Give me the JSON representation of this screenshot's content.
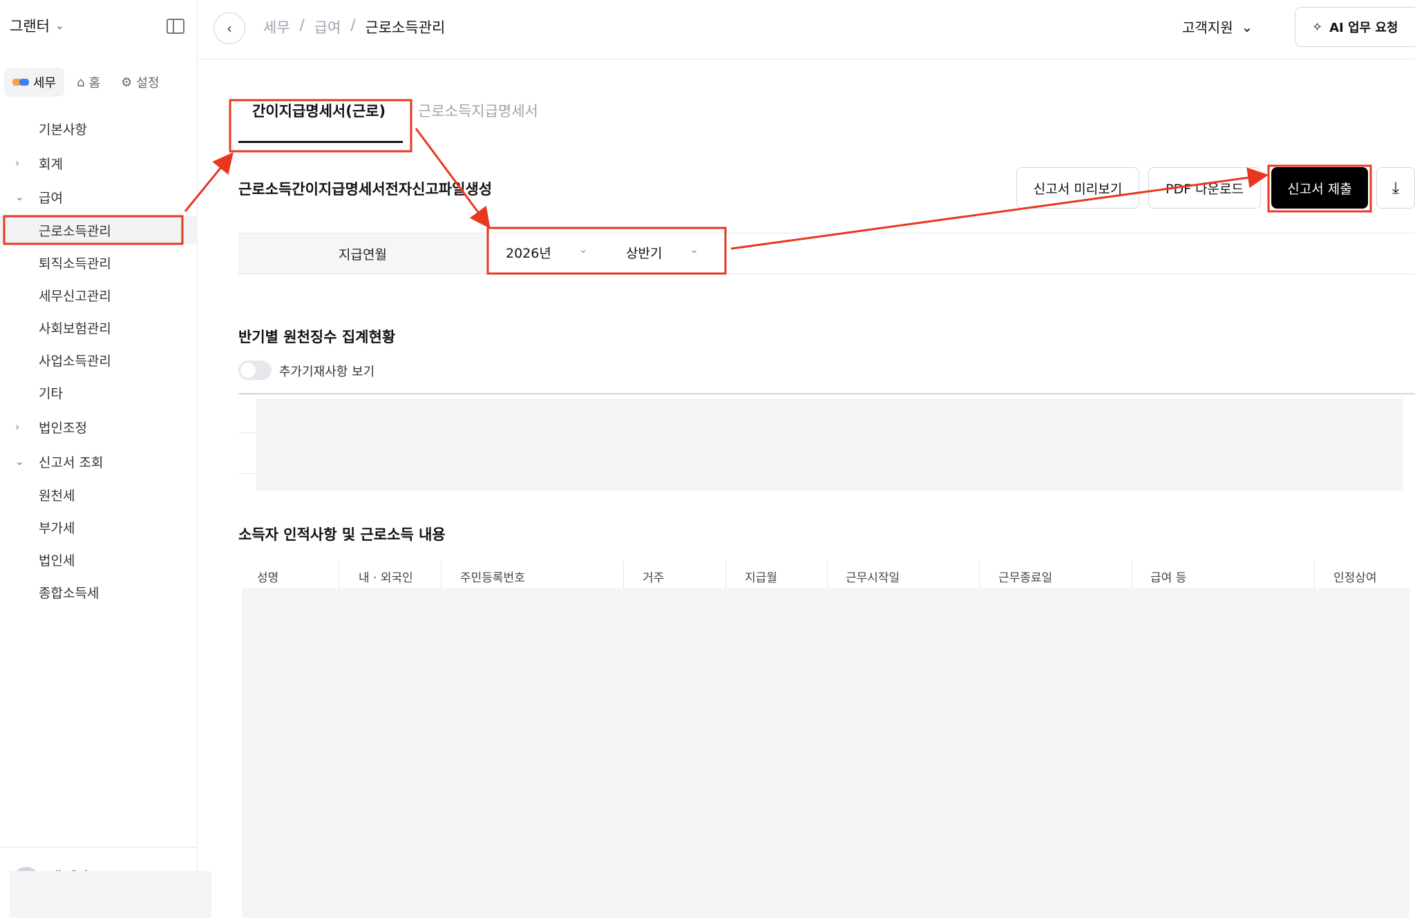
{
  "sidebar": {
    "org_name": "그랜터",
    "tabs": [
      {
        "label": "세무"
      },
      {
        "label": "홈"
      },
      {
        "label": "설정"
      }
    ],
    "items": [
      {
        "label": "기본사항"
      },
      {
        "label": "회계"
      },
      {
        "label": "급여"
      },
      {
        "label": "근로소득관리"
      },
      {
        "label": "퇴직소득관리"
      },
      {
        "label": "세무신고관리"
      },
      {
        "label": "사회보험관리"
      },
      {
        "label": "사업소득관리"
      },
      {
        "label": "기타"
      },
      {
        "label": "법인조정"
      },
      {
        "label": "신고서 조회"
      },
      {
        "label": "원천세"
      },
      {
        "label": "부가세"
      },
      {
        "label": "법인세"
      },
      {
        "label": "종합소득세"
      }
    ],
    "profile_name": "내 계정"
  },
  "header": {
    "breadcrumb": [
      "세무",
      "급여",
      "근로소득관리"
    ],
    "help_label": "고객지원",
    "ai_label": "AI 업무 요청"
  },
  "main": {
    "tabs": [
      {
        "label": "간이지급명세서(근로)",
        "active": true
      },
      {
        "label": "근로소득지급명세서",
        "active": false
      }
    ],
    "section_title": "근로소득간이지급명세서전자신고파일생성",
    "buttons": {
      "preview": "신고서 미리보기",
      "pdf": "PDF 다운로드",
      "submit": "신고서 제출"
    },
    "filter": {
      "label": "지급연월",
      "year": "2026년",
      "half": "상반기"
    },
    "summary_title": "반기별 원천징수 집계현황",
    "toggle_label": "추가기재사항 보기",
    "details_title": "소득자 인적사항 및 근로소득 내용",
    "columns": [
      "성명",
      "내 · 외국인",
      "주민등록번호",
      "거주",
      "지급월",
      "근무시작일",
      "근무종료일",
      "급여 등",
      "인정상여"
    ]
  },
  "colors": {
    "annotation_red": "#e8371f",
    "primary_black": "#000000"
  }
}
